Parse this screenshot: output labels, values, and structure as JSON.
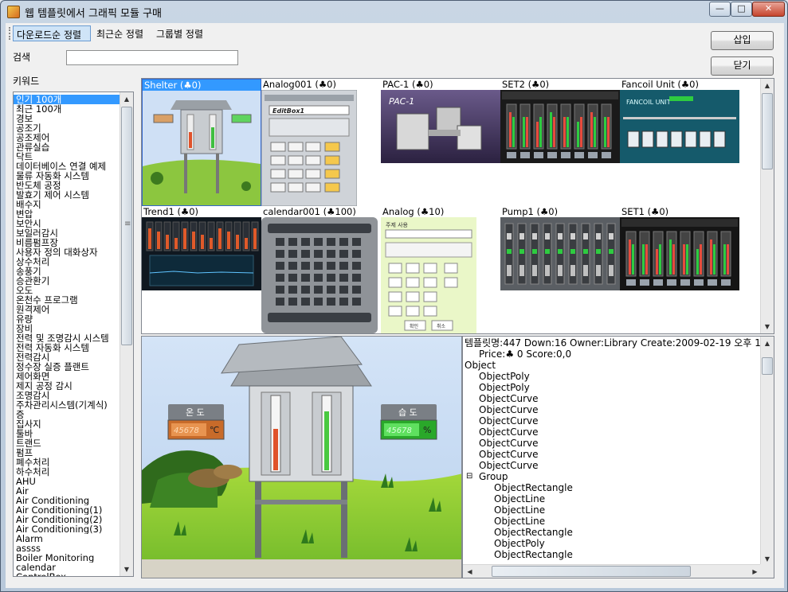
{
  "window": {
    "title": "웹 템플릿에서 그래픽 모듈 구매",
    "minimize": "—",
    "maximize": "□",
    "close": "✕"
  },
  "tabs": [
    {
      "label": "다운로드순 정렬"
    },
    {
      "label": "최근순 정렬"
    },
    {
      "label": "그룹별 정렬"
    }
  ],
  "buttons": {
    "insert": "삽입",
    "close": "닫기"
  },
  "search": {
    "label": "검색",
    "value": "",
    "placeholder": ""
  },
  "keyword": {
    "label": "키워드",
    "items": [
      "인기 100개",
      "최근 100개",
      "경보",
      "공조기",
      "공조제어",
      "관류실습",
      "닥트",
      "데이터베이스 연결 예제",
      "물류 자동화 시스템",
      "반도체 공정",
      "발효기 제어 시스템",
      "배수지",
      "변압",
      "보안시",
      "보일러감시",
      "비름펌프장",
      "사용자 정의 대화상자",
      "상수처리",
      "송풍기",
      "승관환기",
      "오도",
      "온천수 프로그램",
      "원격제어",
      "유량",
      "장비",
      "전력 및 조명감시 시스템",
      "전력 자동화 시스템",
      "전력감시",
      "정수장 실증 플랜트",
      "제어화면",
      "제지 공정 감시",
      "조명감시",
      "주차관리시스템(기계식)",
      "증",
      "집사지",
      "툴바",
      "트랜드",
      "펌프",
      "폐수처리",
      "하수처리",
      "AHU",
      "Air",
      "Air Conditioning",
      "Air Conditioning(1)",
      "Air Conditioning(2)",
      "Air Conditioning(3)",
      "Alarm",
      "assss",
      "Boiler Monitoring",
      "calendar",
      "ControlBox"
    ],
    "selected_index": 0
  },
  "gallery": {
    "tiles": [
      {
        "title": "Shelter (♣0)",
        "selected": true,
        "icon": "shelter-thumbnail"
      },
      {
        "title": "Analog001 (♣0)",
        "icon": "analog-editbox-thumbnail"
      },
      {
        "title": "PAC-1 (♣0)",
        "icon": "pac-machine-thumbnail"
      },
      {
        "title": "SET2 (♣0)",
        "icon": "gauge-set-thumbnail"
      },
      {
        "title": "Fancoil Unit (♣0)",
        "icon": "fancoil-thumbnail"
      },
      {
        "title": "Trend1 (♣0)",
        "icon": "trend-thumbnail"
      },
      {
        "title": "calendar001 (♣100)",
        "icon": "calendar-thumbnail"
      },
      {
        "title": "Analog (♣10)",
        "icon": "analog-panel-thumbnail"
      },
      {
        "title": "Pump1 (♣0)",
        "icon": "pump-thumbnail"
      },
      {
        "title": "SET1 (♣0)",
        "icon": "gauge-set-thumbnail"
      }
    ],
    "analog001_header": "EditBox1",
    "analog_header": "주제 사용",
    "pac_label": "PAC-1",
    "fancoil_label": "FANCOIL UNIT",
    "analog_buttons": [
      "확인",
      "취소"
    ]
  },
  "preview": {
    "temp_label": "온 도",
    "temp_value": "45678",
    "temp_unit": "℃",
    "hum_label": "습 도",
    "hum_value": "45678",
    "hum_unit": "%"
  },
  "tree": {
    "header": "템플릿명:447 Down:16 Owner:Library Create:2009-02-19 오후 12:26",
    "price_line": "Price:♣ 0  Score:0,0",
    "root": "Object",
    "children": [
      "ObjectPoly",
      "ObjectPoly",
      "ObjectCurve",
      "ObjectCurve",
      "ObjectCurve",
      "ObjectCurve",
      "ObjectCurve",
      "ObjectCurve",
      "ObjectCurve"
    ],
    "group_label": "Group",
    "group_toggle": "⊟",
    "group_children": [
      "ObjectRectangle",
      "ObjectLine",
      "ObjectLine",
      "ObjectLine",
      "ObjectRectangle",
      "ObjectPoly",
      "ObjectRectangle"
    ]
  },
  "scroll": {
    "up": "▲",
    "down": "▼",
    "left": "◀",
    "right": "▶",
    "grip": "≡"
  }
}
